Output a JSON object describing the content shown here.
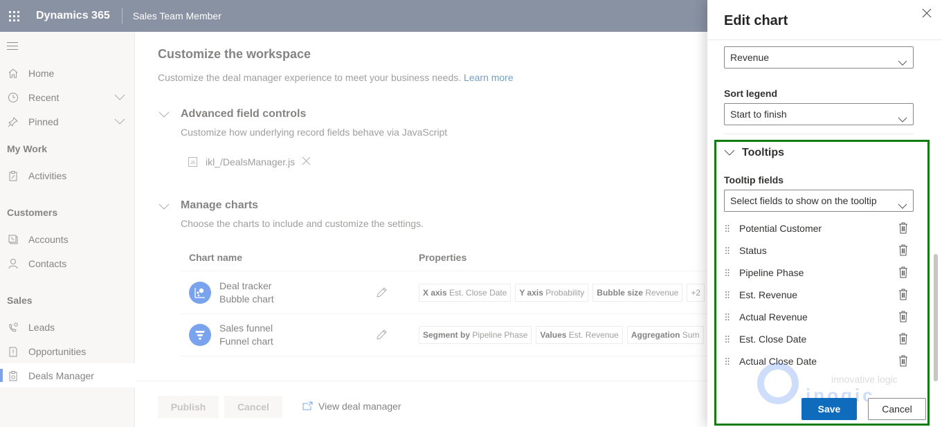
{
  "topbar": {
    "app_name": "Dynamics 365",
    "app_role": "Sales Team Member"
  },
  "sidebar": {
    "items": [
      {
        "label": "Home",
        "icon": "home-icon"
      },
      {
        "label": "Recent",
        "icon": "clock-icon",
        "expandable": true
      },
      {
        "label": "Pinned",
        "icon": "pin-icon",
        "expandable": true
      }
    ],
    "groups": [
      {
        "title": "My Work",
        "items": [
          {
            "label": "Activities",
            "icon": "clipboard-icon"
          }
        ]
      },
      {
        "title": "Customers",
        "items": [
          {
            "label": "Accounts",
            "icon": "accounts-icon"
          },
          {
            "label": "Contacts",
            "icon": "person-icon"
          }
        ]
      },
      {
        "title": "Sales",
        "items": [
          {
            "label": "Leads",
            "icon": "phone-icon"
          },
          {
            "label": "Opportunities",
            "icon": "opportunity-icon"
          },
          {
            "label": "Deals Manager",
            "icon": "deals-icon",
            "active": true
          }
        ]
      }
    ]
  },
  "main": {
    "title": "Customize the workspace",
    "subtitle": "Customize the deal manager experience to meet your business needs.",
    "learn_more": "Learn more",
    "advanced": {
      "title": "Advanced field controls",
      "desc": "Customize how underlying record fields behave via JavaScript",
      "file_badge": "JS",
      "file_name": "ikl_/DealsManager.js"
    },
    "charts": {
      "title": "Manage charts",
      "desc": "Choose the charts to include and customize the settings.",
      "col_name": "Chart name",
      "col_props": "Properties",
      "rows": [
        {
          "name": "Deal tracker",
          "type": "Bubble chart",
          "icon": "bubble-chart-icon",
          "props": [
            {
              "key": "X axis",
              "value": "Est. Close Date"
            },
            {
              "key": "Y axis",
              "value": "Probability"
            },
            {
              "key": "Bubble size",
              "value": "Revenue"
            },
            {
              "key": "",
              "value": "+2"
            }
          ]
        },
        {
          "name": "Sales funnel",
          "type": "Funnel chart",
          "icon": "funnel-chart-icon",
          "props": [
            {
              "key": "Segment by",
              "value": "Pipeline Phase"
            },
            {
              "key": "Values",
              "value": "Est. Revenue"
            },
            {
              "key": "Aggregation",
              "value": "Sum"
            }
          ]
        }
      ]
    },
    "footer": {
      "publish": "Publish",
      "cancel": "Cancel",
      "view": "View deal manager"
    }
  },
  "panel": {
    "title": "Edit chart",
    "bubble_size_value": "Revenue",
    "sort_legend_label": "Sort legend",
    "sort_legend_value": "Start to finish",
    "tooltips_title": "Tooltips",
    "tooltip_fields_label": "Tooltip fields",
    "tooltip_fields_placeholder": "Select fields to show on the tooltip",
    "tooltip_items": [
      "Potential Customer",
      "Status",
      "Pipeline Phase",
      "Est. Revenue",
      "Actual Revenue",
      "Est. Close Date",
      "Actual Close Date"
    ],
    "save": "Save",
    "cancel": "Cancel",
    "watermark_text": "innovative logic",
    "watermark_logo": "inogic"
  },
  "colors": {
    "topbar": "#3b4a66",
    "accent": "#2266e3",
    "save": "#0f6cbd",
    "highlight": "#107c10"
  }
}
